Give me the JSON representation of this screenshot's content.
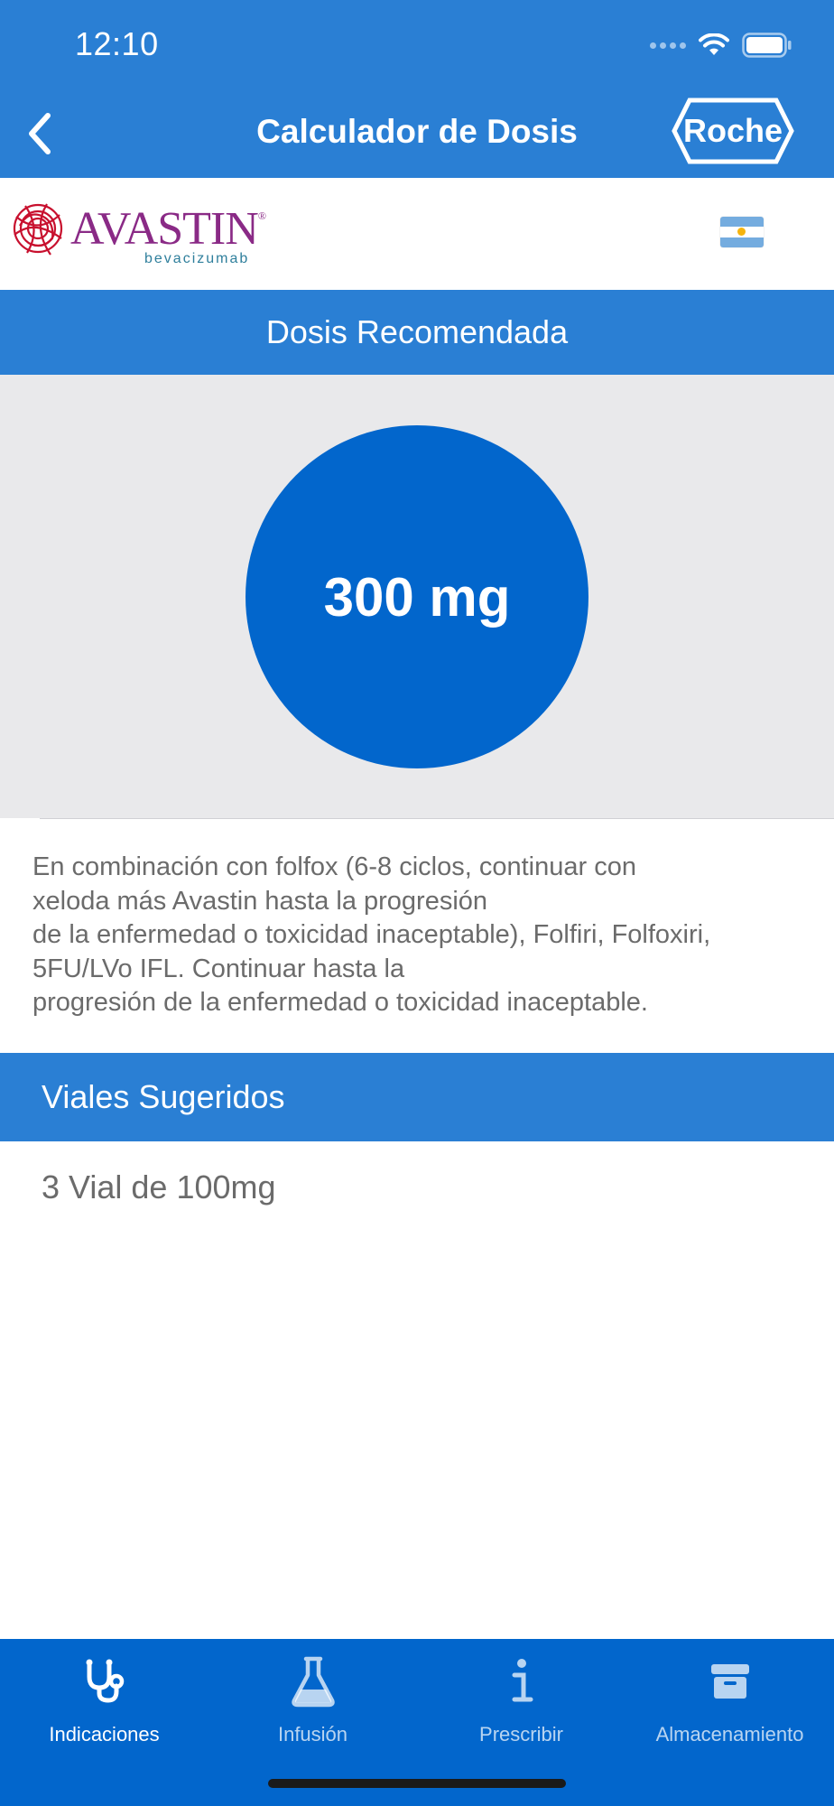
{
  "status_bar": {
    "time": "12:10"
  },
  "nav": {
    "title": "Calculador de Dosis",
    "brand": "Roche"
  },
  "product": {
    "name": "AVASTIN",
    "registered": "®",
    "generic": "bevacizumab",
    "flag": "argentina-flag"
  },
  "dose": {
    "header": "Dosis Recomendada",
    "value": "300 mg"
  },
  "description_lines": [
    "En combinación con folfox (6-8 ciclos, continuar con",
    "xeloda más Avastin hasta la progresión",
    "de la enfermedad o toxicidad inaceptable), Folfiri, Folfoxiri,",
    "5FU/LVo IFL. Continuar hasta la",
    "progresión de la enfermedad o toxicidad inaceptable."
  ],
  "vials": {
    "header": "Viales Sugeridos",
    "value": "3 Vial de 100mg"
  },
  "tabs": [
    {
      "label": "Indicaciones",
      "icon": "stethoscope-icon",
      "active": true
    },
    {
      "label": "Infusión",
      "icon": "flask-icon",
      "active": false
    },
    {
      "label": "Prescribir",
      "icon": "info-icon",
      "active": false
    },
    {
      "label": "Almacenamiento",
      "icon": "archive-box-icon",
      "active": false
    }
  ],
  "colors": {
    "primary": "#2a7fd4",
    "dose_circle": "#0266cc",
    "tab_bar": "#0266cc",
    "brand_purple": "#8a2a86"
  }
}
